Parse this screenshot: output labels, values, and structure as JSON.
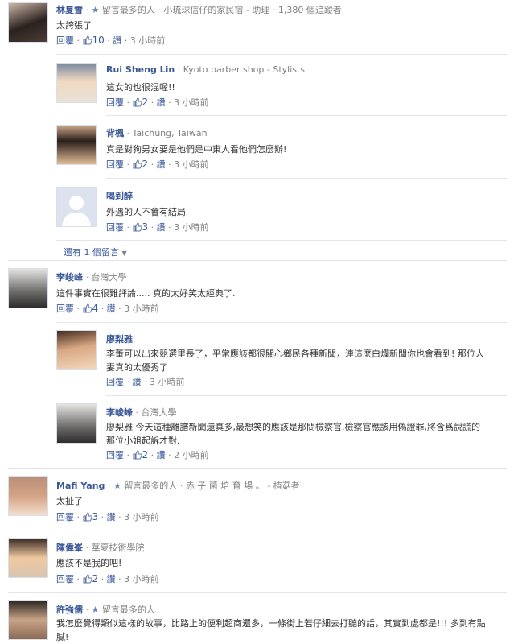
{
  "actions": {
    "reply": "回覆",
    "like": "讚",
    "dot": "·"
  },
  "comments": [
    {
      "author": "林夏雪",
      "badge": "留言最多的人",
      "meta": "小琉球信仔的家民宿 - 助理",
      "meta2": "1,380 個追蹤者",
      "text": "太誇張了",
      "likes": "10",
      "time": "3 小時前",
      "avatar": "woman-photo-avatar"
    },
    {
      "author": "Rui Sheng Lin",
      "meta": "Kyoto barber shop - Stylists",
      "text": "這女的也很混喔!!",
      "likes": "2",
      "time": "3 小時前",
      "avatar": "man-with-baby-avatar"
    },
    {
      "author": "背楓",
      "meta": "Taichung, Taiwan",
      "text": "真是對狗男女要是他們是中東人看他們怎麼辦!",
      "likes": "2",
      "time": "3 小時前",
      "avatar": "young-man-avatar"
    },
    {
      "author": "喝到醉",
      "text": "外遇的人不會有結局",
      "likes": "3",
      "time": "3 小時前",
      "avatar": "default-profile-avatar"
    },
    {
      "author": "李峻峰",
      "meta": "台灣大學",
      "text": "這件事實在很難評論..... 真的太好笑太經典了.",
      "likes": "4",
      "time": "3 小時前",
      "avatar": "man-glasses-avatar"
    },
    {
      "author": "廖梨雅",
      "text": "李董可以出來競選里長了，平常應該都很關心鄉民各種新聞，連這麼白爛新聞你也會看到! 那位人妻真的太優秀了",
      "time": "3 小時前",
      "avatar": "woman-smiling-avatar"
    },
    {
      "author": "李峻峰",
      "meta": "台灣大學",
      "text": "廖梨雅 今天這種離譜新聞還真多,最想笑的應該是那問檢察官.檢察官應該用偽證罪,將含爲說謊的那位小姐起訴才對.",
      "likes": "2",
      "time": "2 小時前",
      "avatar": "man-glasses-avatar-2"
    },
    {
      "author": "Mafi Yang",
      "badge": "留言最多的人",
      "meta": "赤 子 菌 培 育 場 。 - 植菇者",
      "text": "太扯了",
      "likes": "3",
      "time": "3 小時前",
      "avatar": "woman-portrait-avatar"
    },
    {
      "author": "陳偉峯",
      "meta": "華夏技術學院",
      "text": "應該不是我的吧!",
      "likes": "2",
      "time": "3 小時前",
      "avatar": "child-avatar"
    },
    {
      "author": "許強儒",
      "badge": "留言最多的人",
      "text": "我怎麼覺得類似這樣的故事，比路上的便利超商還多，一條街上若仔細去打聽的話，其實到處都是!!! 多到有點膩!",
      "avatar": "man-face-avatar"
    }
  ],
  "more_replies": "還有 1 個留言"
}
